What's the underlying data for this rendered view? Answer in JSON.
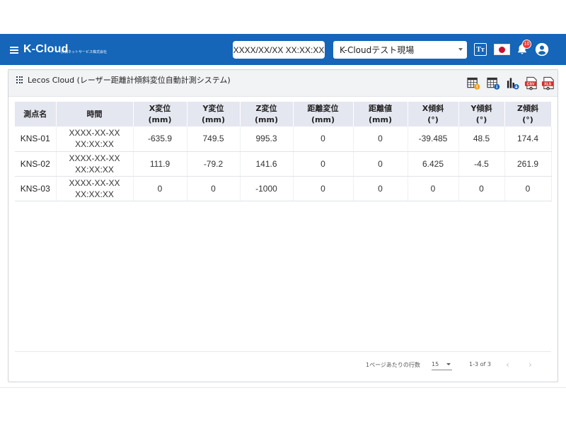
{
  "header": {
    "brand": "K-Cloud",
    "brand_sub": "計測ネットサービス株式会社",
    "datetime": "XXXX/XX/XX XX:XX:XX",
    "site": "K-Cloudテスト現場",
    "font_button": "Tт",
    "notification_count": "10",
    "icons": [
      "menu-icon",
      "font-size-icon",
      "japan-flag-icon",
      "bell-icon",
      "account-icon"
    ]
  },
  "panel": {
    "title": "Lecos Cloud (レーザー距離計傾斜変位自動計測システム)",
    "tools": [
      {
        "name": "calendar-warning-icon"
      },
      {
        "name": "calendar-info-icon"
      },
      {
        "name": "bar-chart-download-icon"
      },
      {
        "name": "csv-download-icon",
        "label": "CSV"
      },
      {
        "name": "xls-download-icon",
        "label": "XLS"
      }
    ]
  },
  "table": {
    "headers": [
      {
        "l1": "測点名",
        "l2": ""
      },
      {
        "l1": "時間",
        "l2": ""
      },
      {
        "l1": "X変位",
        "l2": "(mm)"
      },
      {
        "l1": "Y変位",
        "l2": "(mm)"
      },
      {
        "l1": "Z変位",
        "l2": "(mm)"
      },
      {
        "l1": "距離変位",
        "l2": "(mm)"
      },
      {
        "l1": "距離値",
        "l2": "(mm)"
      },
      {
        "l1": "X傾斜",
        "l2": "(°)"
      },
      {
        "l1": "Y傾斜",
        "l2": "(°)"
      },
      {
        "l1": "Z傾斜",
        "l2": "(°)"
      }
    ],
    "rows": [
      {
        "point": "KNS-01",
        "date": "XXXX-XX-XX",
        "time": "XX:XX:XX",
        "x_disp": "-635.9",
        "y_disp": "749.5",
        "z_disp": "995.3",
        "dist_disp": "0",
        "dist_val": "0",
        "x_tilt": "-39.485",
        "y_tilt": "48.5",
        "z_tilt": "174.4"
      },
      {
        "point": "KNS-02",
        "date": "XXXX-XX-XX",
        "time": "XX:XX:XX",
        "x_disp": "111.9",
        "y_disp": "-79.2",
        "z_disp": "141.6",
        "dist_disp": "0",
        "dist_val": "0",
        "x_tilt": "6.425",
        "y_tilt": "-4.5",
        "z_tilt": "261.9"
      },
      {
        "point": "KNS-03",
        "date": "XXXX-XX-XX",
        "time": "XX:XX:XX",
        "x_disp": "0",
        "y_disp": "0",
        "z_disp": "-1000",
        "dist_disp": "0",
        "dist_val": "0",
        "x_tilt": "0",
        "y_tilt": "0",
        "z_tilt": "0"
      }
    ]
  },
  "pagination": {
    "rows_per_page_label": "1ページあたりの行数",
    "rows_per_page": "15",
    "range": "1-3 of 3",
    "prev": "‹",
    "next": "›"
  },
  "colors": {
    "appbar": "#1565b8",
    "header_cell": "#e4e6f0",
    "badge": "#e53935"
  }
}
